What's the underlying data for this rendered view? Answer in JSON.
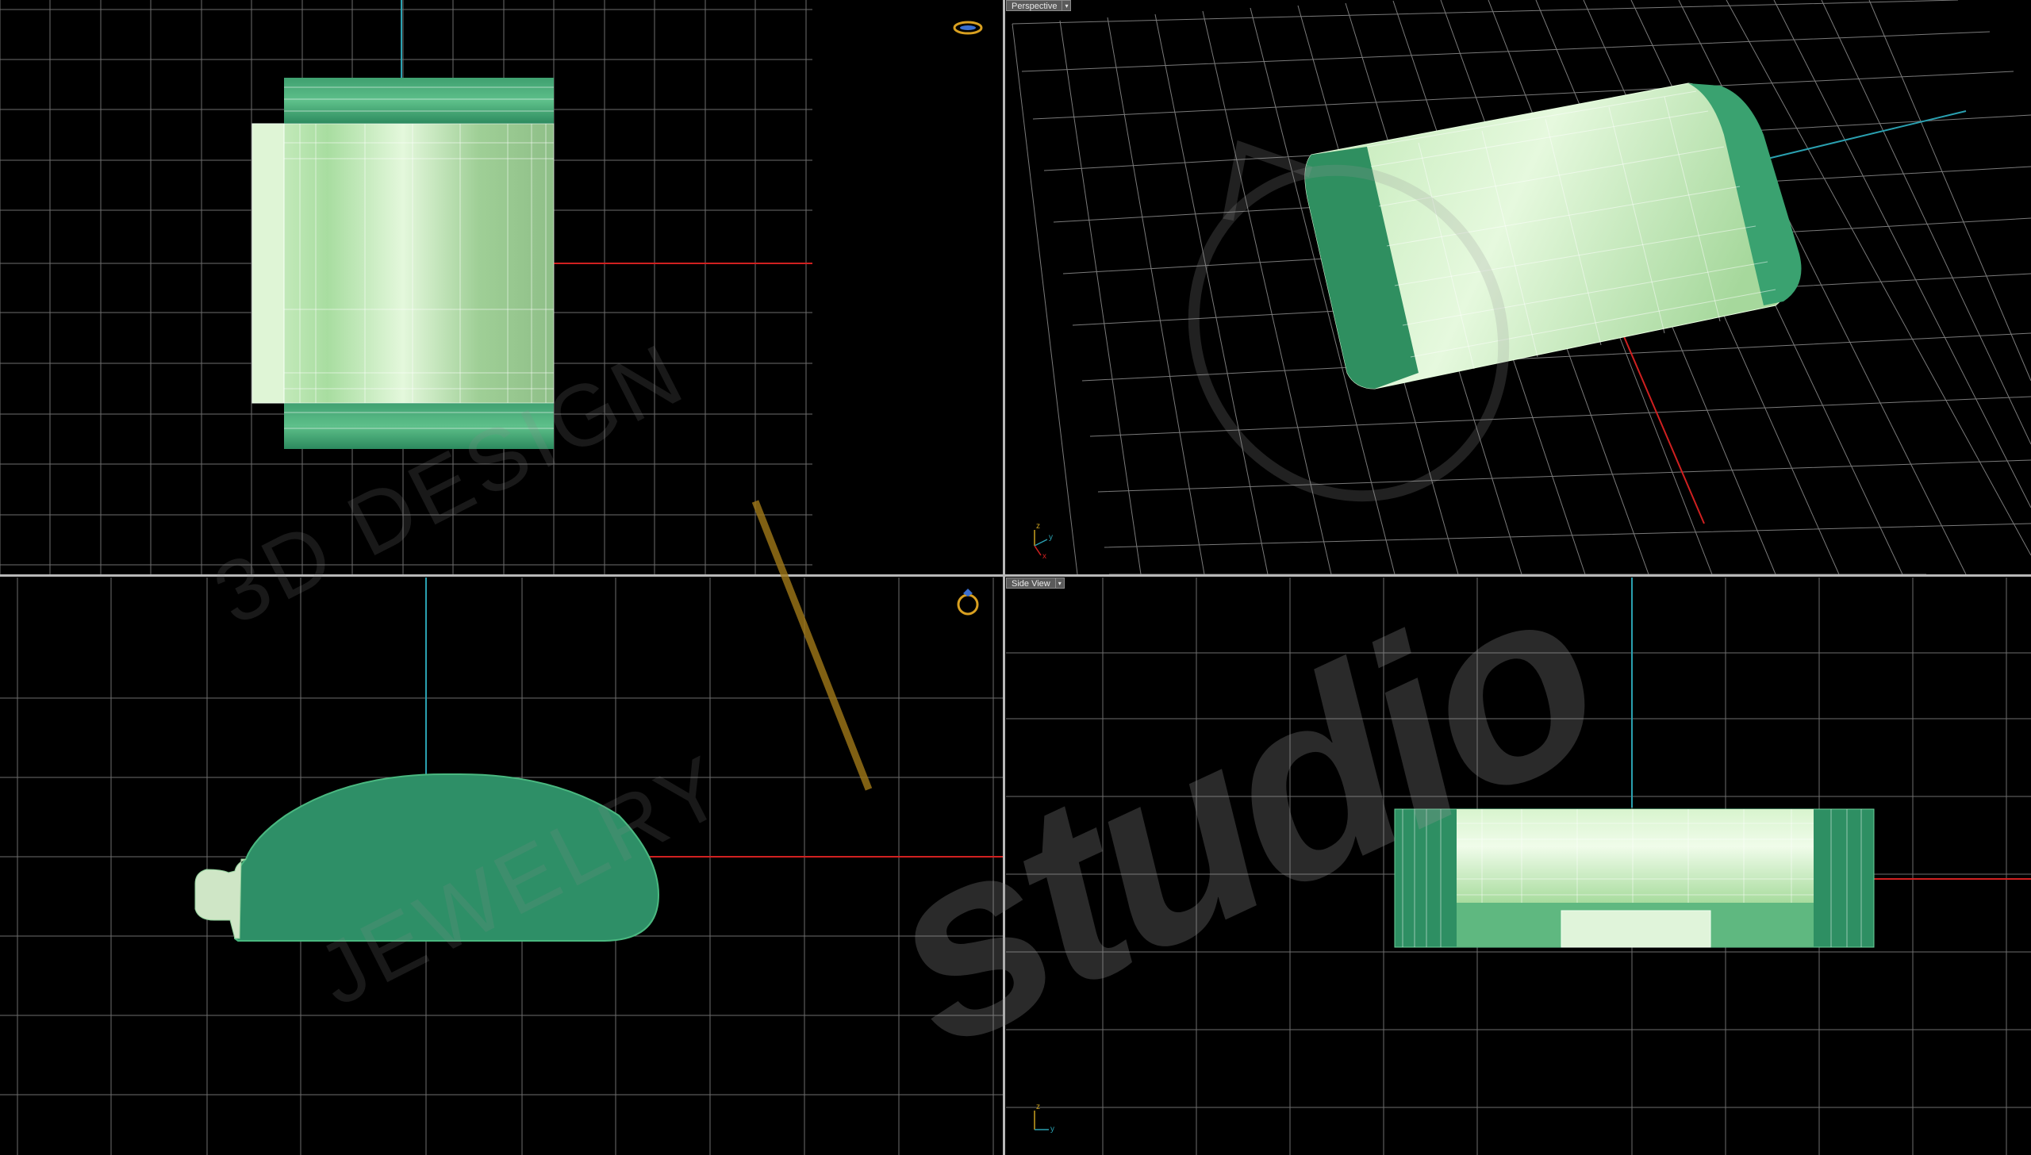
{
  "viewports": {
    "perspective": {
      "label": "Perspective"
    },
    "side": {
      "label": "Side View"
    }
  },
  "axes": {
    "x": "x",
    "y": "y",
    "z": "z"
  },
  "watermark": {
    "line1": "3D DESIGN",
    "line2": "JEWELRY",
    "brand": "studio"
  },
  "colors": {
    "grid": "#7a7a7a",
    "x_axis": "#d02020",
    "y_axis": "#2aa0b0",
    "model_dark": "#2e8f63",
    "model_light": "#c8f0c0",
    "accent_gold": "#c8901a"
  },
  "icons": [
    "ring-icon",
    "viewport-menu-arrow-icon",
    "axis-gizmo-icon"
  ]
}
